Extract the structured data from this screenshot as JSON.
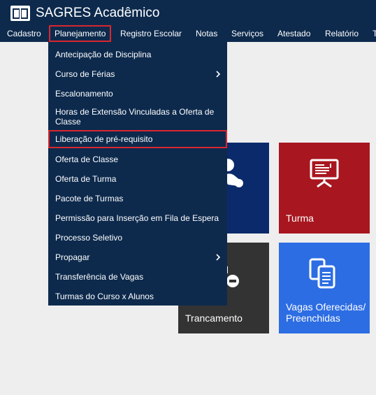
{
  "app": {
    "title": "SAGRES Acadêmico",
    "logo_icon": "book-icon"
  },
  "nav": {
    "items": [
      {
        "label": "Cadastro"
      },
      {
        "label": "Planejamento",
        "active": true
      },
      {
        "label": "Registro Escolar"
      },
      {
        "label": "Notas"
      },
      {
        "label": "Serviços"
      },
      {
        "label": "Atestado"
      },
      {
        "label": "Relatório"
      },
      {
        "label": "T"
      }
    ]
  },
  "planejamento_menu": {
    "items": [
      {
        "label": "Antecipação de Disciplina"
      },
      {
        "label": "Curso de Férias",
        "submenu": true
      },
      {
        "label": "Escalonamento"
      },
      {
        "label": "Horas de Extensão Vinculadas a Oferta de Classe"
      },
      {
        "label": "Liberação de pré-requisito",
        "highlighted": true
      },
      {
        "label": "Oferta de Classe"
      },
      {
        "label": "Oferta de Turma"
      },
      {
        "label": "Pacote de Turmas"
      },
      {
        "label": "Permissão para Inserção em Fila de Espera"
      },
      {
        "label": "Processo Seletivo"
      },
      {
        "label": "Propagar",
        "submenu": true
      },
      {
        "label": "Transferência de Vagas"
      },
      {
        "label": "Turmas do Curso x Alunos"
      }
    ]
  },
  "tiles": {
    "navy": {
      "color": "#0b2a6b",
      "icon": "user-icon"
    },
    "turma": {
      "label": "Turma",
      "color": "#a8161f",
      "icon": "presentation-board-icon"
    },
    "trancamento": {
      "label": "Trancamento",
      "color": "#333333",
      "icon": "lock-icon"
    },
    "vagas": {
      "label": "Vagas Oferecidas/ Preenchidas",
      "color": "#2d6de3",
      "icon": "documents-icon"
    }
  },
  "colors": {
    "header_bg": "#0d2a4d",
    "highlight_border": "#d9262f",
    "page_bg": "#eeeeee"
  }
}
